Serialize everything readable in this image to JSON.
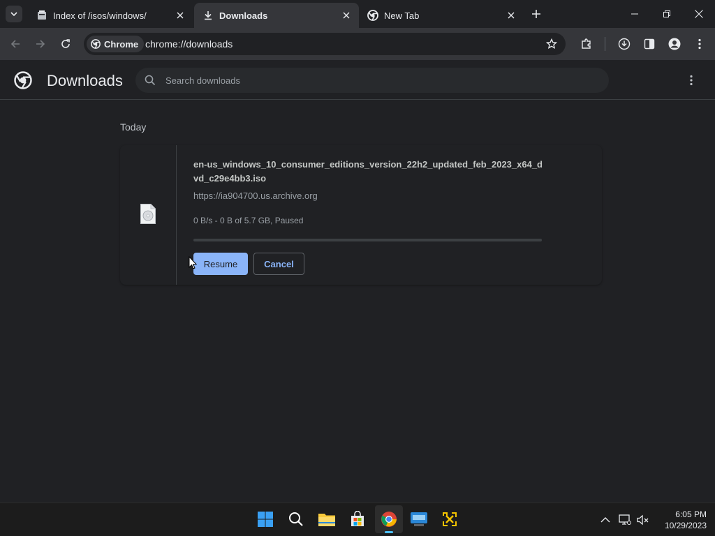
{
  "tabs": [
    {
      "title": "Index of /isos/windows/",
      "icon": "archive-icon"
    },
    {
      "title": "Downloads",
      "icon": "download-icon",
      "active": true
    },
    {
      "title": "New Tab",
      "icon": "chrome-icon"
    }
  ],
  "omnibox": {
    "chip_label": "Chrome",
    "url": "chrome://downloads"
  },
  "page": {
    "title": "Downloads",
    "search_placeholder": "Search downloads"
  },
  "downloads": {
    "date_label": "Today",
    "items": [
      {
        "file_name": "en-us_windows_10_consumer_editions_version_22h2_updated_feb_2023_x64_dvd_c29e4bb3.iso",
        "source_url": "https://ia904700.us.archive.org",
        "status": "0 B/s - 0 B of 5.7 GB, Paused",
        "progress": 0,
        "resume_label": "Resume",
        "cancel_label": "Cancel"
      }
    ]
  },
  "taskbar": {
    "apps": [
      "start-icon",
      "search-icon",
      "file-explorer-icon",
      "store-icon",
      "chrome-icon",
      "keyboard-app-icon",
      "network-tool-icon"
    ],
    "time": "6:05 PM",
    "date": "10/29/2023"
  },
  "colors": {
    "accent": "#8ab4f8",
    "background": "#202124",
    "toolbar": "#35363a"
  }
}
